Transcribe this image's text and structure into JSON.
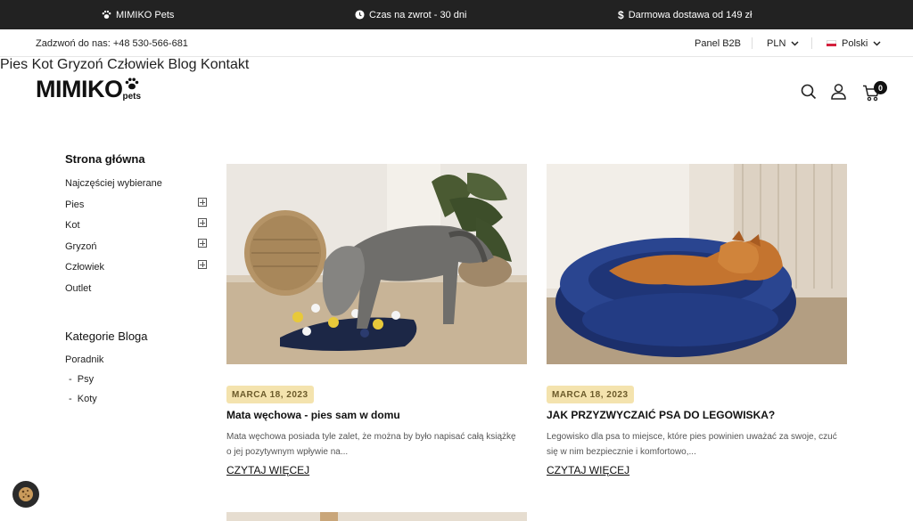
{
  "topbar": {
    "item1": "MIMIKO Pets",
    "item2": "Czas na zwrot - 30 dni",
    "item3": "Darmowa dostawa od 149 zł"
  },
  "utilbar": {
    "phone": "Zadzwoń do nas: +48 530-566-681",
    "b2b": "Panel B2B",
    "currency": "PLN",
    "language": "Polski"
  },
  "header": {
    "logo_main": "MIMIKO",
    "logo_sub": "pets",
    "nav": [
      "Pies",
      "Kot",
      "Gryzoń",
      "Człowiek",
      "Blog",
      "Kontakt"
    ],
    "cart_count": "0"
  },
  "sidebar": {
    "title": "Strona główna",
    "items": [
      {
        "label": "Najczęściej wybierane",
        "expandable": false
      },
      {
        "label": "Pies",
        "expandable": true
      },
      {
        "label": "Kot",
        "expandable": true
      },
      {
        "label": "Gryzoń",
        "expandable": true
      },
      {
        "label": "Człowiek",
        "expandable": true
      },
      {
        "label": "Outlet",
        "expandable": false
      }
    ],
    "blog_title": "Kategorie Bloga",
    "blog_items": [
      "Poradnik",
      "-  Psy",
      "-  Koty"
    ]
  },
  "posts": [
    {
      "date": "MARCA 18, 2023",
      "title": "Mata węchowa - pies sam w domu",
      "excerpt": "Mata węchowa posiada tyle zalet, że można by było napisać całą książkę o jej pozytywnym wpływie na...",
      "more": "CZYTAJ WIĘCEJ"
    },
    {
      "date": "MARCA 18, 2023",
      "title": "JAK PRZYZWYCZAIĆ PSA DO LEGOWISKA?",
      "excerpt": "Legowisko dla psa to miejsce, które pies powinien uważać za swoje, czuć się w nim bezpiecznie i komfortowo,...",
      "more": "CZYTAJ WIĘCEJ"
    }
  ],
  "colors": {
    "topbar_bg": "#222222",
    "date_badge": "#f4e3ae",
    "bed_blue": "#243d86",
    "dog_orange": "#c4742f"
  }
}
